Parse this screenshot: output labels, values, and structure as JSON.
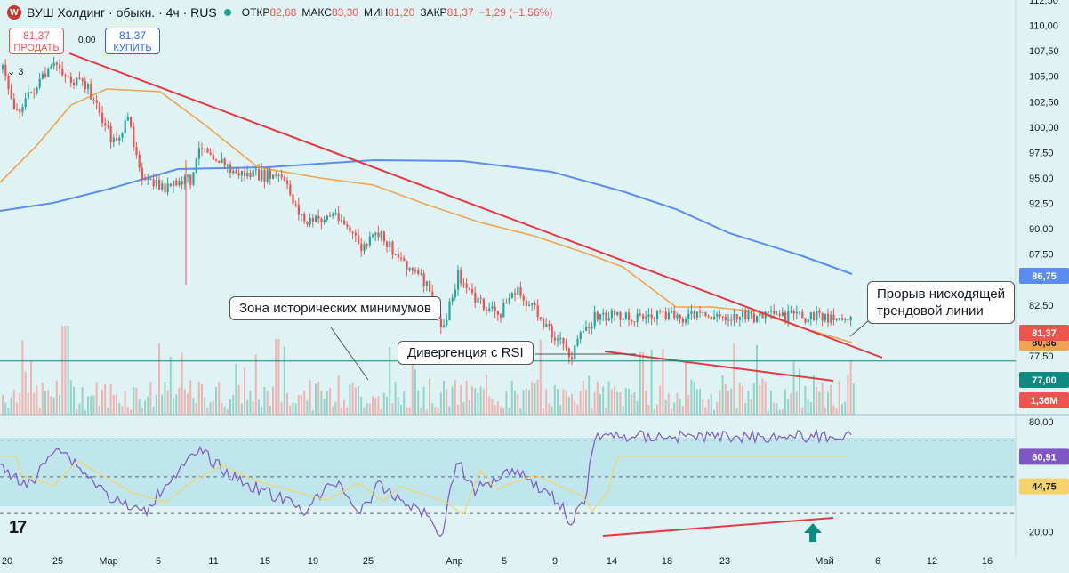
{
  "header": {
    "logo_letter": "W",
    "title": "ВУШ Холдинг · обыкн. · 4ч · RUS",
    "open_label": "ОТКР",
    "open": "82,68",
    "high_label": "МАКС",
    "high": "83,30",
    "low_label": "МИН",
    "low": "81,20",
    "close_label": "ЗАКР",
    "close": "81,37",
    "change": "−1,29 (−1,56%)"
  },
  "trade": {
    "sell_price": "81,37",
    "sell_label": "ПРОДАТЬ",
    "spread": "0,00",
    "buy_price": "81,37",
    "buy_label": "КУПИТЬ"
  },
  "indicators_count": "3",
  "annotations": {
    "historical_lows": "Зона исторических минимумов",
    "divergence": "Дивергенция с RSI",
    "breakout_line1": "Прорыв нисходящей",
    "breakout_line2": "трендовой линии"
  },
  "colors": {
    "up": "#26a69a",
    "down": "#ef5350",
    "trendline": "#e53945",
    "ma_fast": "#f0a350",
    "ma_slow": "#5b8def",
    "rsi": "#7e57c2",
    "rsi_ma": "#f6d36a",
    "support": "#0f8a80"
  },
  "chart_data": [
    {
      "type": "candlestick",
      "title": "ВУШ Холдинг · обыкн. · 4ч · RUS",
      "x_tick_labels": [
        "20",
        "25",
        "Мар",
        "5",
        "11",
        "15",
        "19",
        "25",
        "Апр",
        "5",
        "9",
        "14",
        "18",
        "23",
        "Май",
        "6",
        "12",
        "16"
      ],
      "y_tick_labels": [
        "112,50",
        "110,00",
        "107,50",
        "105,00",
        "102,50",
        "100,00",
        "97,50",
        "95,00",
        "92,50",
        "90,00",
        "87,50",
        "85,00",
        "82,50",
        "80,00",
        "77,50"
      ],
      "ylim": [
        74,
        112.5
      ],
      "price_path": [
        {
          "x": "19 фев",
          "y": 106.5
        },
        {
          "x": "21 фев",
          "y": 101.5
        },
        {
          "x": "23 фев",
          "y": 103.5
        },
        {
          "x": "26 фев",
          "y": 106.2
        },
        {
          "x": "28 фев",
          "y": 104.5
        },
        {
          "x": "1 мар",
          "y": 103.8
        },
        {
          "x": "4 мар",
          "y": 98.5
        },
        {
          "x": "6 мар",
          "y": 100.5
        },
        {
          "x": "8 мар",
          "y": 94.5
        },
        {
          "x": "11 мар",
          "y": 94
        },
        {
          "x": "14 мар",
          "y": 95
        },
        {
          "x": "15 мар",
          "y": 98.5
        },
        {
          "x": "19 мар",
          "y": 95.5
        },
        {
          "x": "25 мар",
          "y": 95
        },
        {
          "x": "28 мар",
          "y": 90.5
        },
        {
          "x": "1 апр",
          "y": 91.5
        },
        {
          "x": "4 апр",
          "y": 88
        },
        {
          "x": "6 апр",
          "y": 89.5
        },
        {
          "x": "9 апр",
          "y": 87
        },
        {
          "x": "12 апр",
          "y": 84.5
        },
        {
          "x": "14 апр",
          "y": 80
        },
        {
          "x": "16 апр",
          "y": 85.5
        },
        {
          "x": "18 апр",
          "y": 83
        },
        {
          "x": "21 апр",
          "y": 81.5
        },
        {
          "x": "23 апр",
          "y": 84
        },
        {
          "x": "26 апр",
          "y": 81.5
        },
        {
          "x": "29 апр",
          "y": 78.5
        },
        {
          "x": "30 апр",
          "y": 77.5
        },
        {
          "x": "2 мая",
          "y": 80.5
        },
        {
          "x": "3 мая",
          "y": 81.37
        }
      ],
      "last_price_label": "81,37",
      "support_level": 77,
      "support_label": "77,00",
      "ma_fast_label": "80,36",
      "ma_slow_label": "86,75",
      "volume_label": "1,36M"
    },
    {
      "type": "line",
      "title": "RSI",
      "y_tick_labels": [
        "80,00",
        "20,00"
      ],
      "levels": [
        70,
        50,
        30
      ],
      "ylim": [
        15,
        80
      ],
      "current_rsi": "60,91",
      "current_rsi_ma": "44,75",
      "rsi_path": [
        {
          "x": "19 фев",
          "y": 55
        },
        {
          "x": "23 фев",
          "y": 45
        },
        {
          "x": "26 фев",
          "y": 68
        },
        {
          "x": "4 мар",
          "y": 38
        },
        {
          "x": "8 мар",
          "y": 30
        },
        {
          "x": "11 мар",
          "y": 48
        },
        {
          "x": "15 мар",
          "y": 64
        },
        {
          "x": "19 мар",
          "y": 50
        },
        {
          "x": "28 мар",
          "y": 32
        },
        {
          "x": "1 апр",
          "y": 48
        },
        {
          "x": "4 апр",
          "y": 30
        },
        {
          "x": "6 апр",
          "y": 45
        },
        {
          "x": "12 апр",
          "y": 30
        },
        {
          "x": "14 апр",
          "y": 18
        },
        {
          "x": "16 апр",
          "y": 60
        },
        {
          "x": "18 апр",
          "y": 42
        },
        {
          "x": "23 апр",
          "y": 55
        },
        {
          "x": "29 апр",
          "y": 35
        },
        {
          "x": "30 апр",
          "y": 22
        },
        {
          "x": "2 мая",
          "y": 40
        },
        {
          "x": "3 мая",
          "y": 72
        }
      ]
    }
  ]
}
